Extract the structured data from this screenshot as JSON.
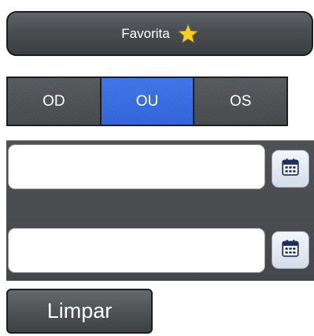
{
  "favorite": {
    "label": "Favorita",
    "icon": "star-icon",
    "star_color": "#f5d21f"
  },
  "eye_selector": {
    "options": [
      "OD",
      "OU",
      "OS"
    ],
    "selected": "OU",
    "active_color": "#3469dd"
  },
  "dates": {
    "start_value": "",
    "end_value": "",
    "calendar_icon": "calendar-icon"
  },
  "clear_button": {
    "label": "Limpar"
  }
}
